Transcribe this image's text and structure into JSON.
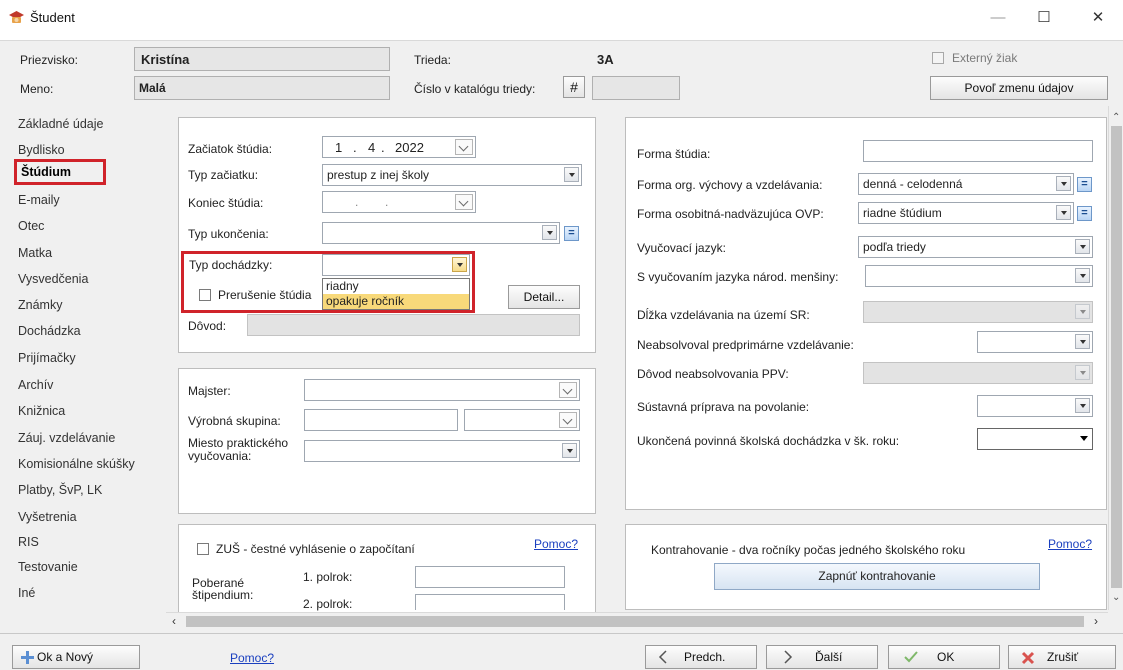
{
  "window": {
    "title": "Študent",
    "minimize": "—",
    "maximize": "☐",
    "close": "✕"
  },
  "header": {
    "priezvisko_label": "Priezvisko:",
    "priezvisko_value": "Kristína",
    "meno_label": "Meno:",
    "meno_value": "Malá",
    "trieda_label": "Trieda:",
    "trieda_value": "3A",
    "cislo_label": "Číslo v katalógu triedy:",
    "hash": "#",
    "externy_label": "Externý žiak",
    "povol_button": "Povoľ zmenu údajov"
  },
  "sidebar": {
    "items": [
      {
        "label": "Základné údaje"
      },
      {
        "label": "Bydlisko"
      },
      {
        "label": "Štúdium"
      },
      {
        "label": "E-maily"
      },
      {
        "label": "Otec"
      },
      {
        "label": "Matka"
      },
      {
        "label": "Vysvedčenia"
      },
      {
        "label": "Známky"
      },
      {
        "label": "Dochádzka"
      },
      {
        "label": "Prijímačky"
      },
      {
        "label": "Archív"
      },
      {
        "label": "Knižnica"
      },
      {
        "label": "Záuj. vzdelávanie"
      },
      {
        "label": "Komisionálne skúšky"
      },
      {
        "label": "Platby, ŠvP, LK"
      },
      {
        "label": "Vyšetrenia"
      },
      {
        "label": "RIS"
      },
      {
        "label": "Testovanie"
      },
      {
        "label": "Iné"
      }
    ]
  },
  "study": {
    "zaciatok_label": "Začiatok štúdia:",
    "zaciatok_day": "1",
    "zaciatok_month": "4",
    "zaciatok_year": "2022",
    "date_dot": ".",
    "typ_zaciatku_label": "Typ začiatku:",
    "typ_zaciatku_value": "prestup z inej školy",
    "koniec_label": "Koniec štúdia:",
    "typ_ukoncenia_label": "Typ ukončenia:",
    "typ_dochadzky_label": "Typ dochádzky:",
    "dropdown_options": [
      "riadny",
      "opakuje ročník"
    ],
    "prerusenie_label": "Prerušenie štúdia",
    "detail_button": "Detail...",
    "dovod_label": "Dôvod:",
    "eq": "="
  },
  "practical": {
    "majster_label": "Majster:",
    "vyrobna_label": "Výrobná skupina:",
    "miesto_label_1": "Miesto praktického",
    "miesto_label_2": "vyučovania:"
  },
  "zus": {
    "checkbox_label": "ZUŠ - čestné vyhlásenie o započítaní",
    "help": "Pomoc?",
    "poberane_1": "Poberané",
    "poberane_2": "štipendium:",
    "polrok1": "1. polrok:",
    "polrok2": "2. polrok:"
  },
  "right": {
    "forma_studia_label": "Forma štúdia:",
    "forma_org_label": "Forma org. výchovy a vzdelávania:",
    "forma_org_value": "denná - celodenná",
    "forma_osob_label": "Forma osobitná-nadväzujúca OVP:",
    "forma_osob_value": "riadne štúdium",
    "jazyk_label": "Vyučovací jazyk:",
    "jazyk_value": "podľa triedy",
    "mensiny_label": "S vyučovaním jazyka národ. menšiny:",
    "dlzka_label": "Dĺžka vzdelávania na území SR:",
    "neabsolvoval_label": "Neabsolvoval predprimárne vzdelávanie:",
    "dovod_ppv_label": "Dôvod neabsolvovania PPV:",
    "sustavna_label": "Sústavná príprava na povolanie:",
    "ukoncena_label": "Ukončená povinná školská dochádzka v šk. roku:"
  },
  "kontra": {
    "label": "Kontrahovanie - dva ročníky počas jedného školského roku",
    "help": "Pomoc?",
    "button": "Zapnúť kontrahovanie"
  },
  "footer": {
    "ok_novy": "Ok a Nový",
    "pomoc": "Pomoc?",
    "predch": "Predch.",
    "dalsi": "Ďalší",
    "ok": "OK",
    "zrusit": "Zrušiť"
  },
  "colors": {
    "highlight": "#d0232a",
    "selected_option": "#f8d97a",
    "link": "#1a3fbf"
  }
}
